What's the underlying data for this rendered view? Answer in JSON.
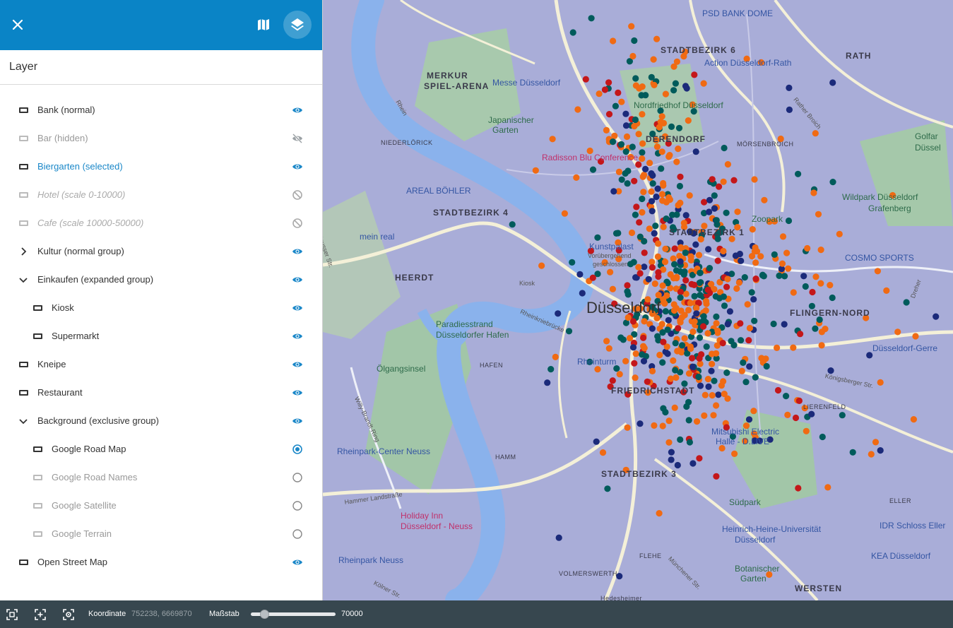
{
  "header": {
    "close_icon": "close-icon",
    "map_icon": "map-icon",
    "layers_icon": "layers-icon",
    "accent_color": "#0a84c6"
  },
  "panel": {
    "title": "Layer"
  },
  "layers": [
    {
      "label": "Bank (normal)",
      "level": 0,
      "state": "visible"
    },
    {
      "label": "Bar (hidden)",
      "level": 0,
      "state": "hidden"
    },
    {
      "label": "Biergarten (selected)",
      "level": 0,
      "state": "selected"
    },
    {
      "label": "Hotel (scale 0-10000)",
      "level": 0,
      "state": "outofscale"
    },
    {
      "label": "Cafe (scale 10000-50000)",
      "level": 0,
      "state": "outofscale"
    },
    {
      "label": "Kultur (normal group)",
      "level": 0,
      "state": "visible",
      "group": "collapsed"
    },
    {
      "label": "Einkaufen (expanded group)",
      "level": 0,
      "state": "visible",
      "group": "expanded"
    },
    {
      "label": "Kiosk",
      "level": 1,
      "state": "visible"
    },
    {
      "label": "Supermarkt",
      "level": 1,
      "state": "visible"
    },
    {
      "label": "Kneipe",
      "level": 0,
      "state": "visible"
    },
    {
      "label": "Restaurant",
      "level": 0,
      "state": "visible"
    },
    {
      "label": "Background (exclusive group)",
      "level": 0,
      "state": "visible",
      "group": "expanded"
    },
    {
      "label": "Google Road Map",
      "level": 1,
      "state": "radio-on"
    },
    {
      "label": "Google Road Names",
      "level": 1,
      "state": "radio-off"
    },
    {
      "label": "Google Satellite",
      "level": 1,
      "state": "radio-off"
    },
    {
      "label": "Google Terrain",
      "level": 1,
      "state": "radio-off"
    },
    {
      "label": "Open Street Map",
      "level": 0,
      "state": "visible"
    }
  ],
  "map": {
    "labels": [
      {
        "text": "STADTBEZIRK 6",
        "cls": "ml-district"
      },
      {
        "text": "RATH",
        "cls": "ml-district"
      },
      {
        "text": "PSD BANK DOME",
        "cls": "ml-poi-blue"
      },
      {
        "text": "MERKUR",
        "cls": "ml-district"
      },
      {
        "text": "SPIEL-ARENA",
        "cls": "ml-district"
      },
      {
        "text": "Messe Düsseldorf",
        "cls": "ml-poi-blue"
      },
      {
        "text": "Japanischer",
        "cls": "ml-poi"
      },
      {
        "text": "Garten",
        "cls": "ml-poi"
      },
      {
        "text": "Nordfriedhof Düsseldorf",
        "cls": "ml-poi"
      },
      {
        "text": "Action Düsseldorf-Rath",
        "cls": "ml-poi-blue"
      },
      {
        "text": "NIEDERLÖRICK",
        "cls": "ml-area"
      },
      {
        "text": "DERENDORF",
        "cls": "ml-district"
      },
      {
        "text": "MÖRSENBROICH",
        "cls": "ml-area"
      },
      {
        "text": "Radisson Blu Conference",
        "cls": "ml-poi-pink"
      },
      {
        "text": "Wildpark Düsseldorf",
        "cls": "ml-poi"
      },
      {
        "text": "Grafenberg",
        "cls": "ml-poi"
      },
      {
        "text": "Golfar",
        "cls": "ml-poi"
      },
      {
        "text": "Düssel",
        "cls": "ml-poi"
      },
      {
        "text": "AREAL BÖHLER",
        "cls": "ml-poi-blue"
      },
      {
        "text": "STADTBEZIRK 4",
        "cls": "ml-district"
      },
      {
        "text": "STADTBEZIRK 1",
        "cls": "ml-district"
      },
      {
        "text": "Zoopark",
        "cls": "ml-poi"
      },
      {
        "text": "mein real",
        "cls": "ml-poi-blue"
      },
      {
        "text": "Kunstpalast",
        "cls": "ml-poi-blue"
      },
      {
        "text": "Vorübergehend",
        "cls": "ml-street"
      },
      {
        "text": "geschlossen",
        "cls": "ml-street"
      },
      {
        "text": "COSMO SPORTS",
        "cls": "ml-poi-blue"
      },
      {
        "text": "HEERDT",
        "cls": "ml-district"
      },
      {
        "text": "Düsseldorf",
        "cls": "ml-city"
      },
      {
        "text": "FLINGERN-NORD",
        "cls": "ml-district"
      },
      {
        "text": "Paradiesstrand",
        "cls": "ml-poi"
      },
      {
        "text": "Düsseldorfer Hafen",
        "cls": "ml-poi"
      },
      {
        "text": "Rheinturm",
        "cls": "ml-poi-blue"
      },
      {
        "text": "Ölgangsinsel",
        "cls": "ml-poi"
      },
      {
        "text": "HAFEN",
        "cls": "ml-area"
      },
      {
        "text": "FRIEDRICHSTADT",
        "cls": "ml-district"
      },
      {
        "text": "LIERENFELD",
        "cls": "ml-area"
      },
      {
        "text": "Düsseldorf-Gerre",
        "cls": "ml-poi-blue"
      },
      {
        "text": "Rheinpark-Center Neuss",
        "cls": "ml-poi-blue"
      },
      {
        "text": "HAMM",
        "cls": "ml-area"
      },
      {
        "text": "Mitsubishi Electric",
        "cls": "ml-poi-blue"
      },
      {
        "text": "Halle - D.LIVE",
        "cls": "ml-poi-blue"
      },
      {
        "text": "STADTBEZIRK 3",
        "cls": "ml-district"
      },
      {
        "text": "Holiday Inn",
        "cls": "ml-poi-pink"
      },
      {
        "text": "Düsseldorf - Neuss",
        "cls": "ml-poi-pink"
      },
      {
        "text": "Südpark",
        "cls": "ml-poi"
      },
      {
        "text": "ELLER",
        "cls": "ml-area"
      },
      {
        "text": "IDR Schloss Eller",
        "cls": "ml-poi-blue"
      },
      {
        "text": "Heinrich-Heine-Universität",
        "cls": "ml-poi-blue"
      },
      {
        "text": "Düsseldorf",
        "cls": "ml-poi-blue"
      },
      {
        "text": "Rheinpark Neuss",
        "cls": "ml-poi-blue"
      },
      {
        "text": "FLEHE",
        "cls": "ml-area"
      },
      {
        "text": "VOLMERSWERTH",
        "cls": "ml-area"
      },
      {
        "text": "Botanischer",
        "cls": "ml-poi"
      },
      {
        "text": "Garten",
        "cls": "ml-poi"
      },
      {
        "text": "WERSTEN",
        "cls": "ml-district"
      },
      {
        "text": "KEA Düsseldorf",
        "cls": "ml-poi-blue"
      },
      {
        "text": "Hedesheimer",
        "cls": "ml-area"
      },
      {
        "text": "Neusser Str.",
        "cls": "ml-street"
      },
      {
        "text": "Willy-Brandt-Ring",
        "cls": "ml-street"
      },
      {
        "text": "Hammer Landstraße",
        "cls": "ml-street"
      },
      {
        "text": "Kölner Str.",
        "cls": "ml-street"
      },
      {
        "text": "Rheinkniebrücke",
        "cls": "ml-street"
      },
      {
        "text": "Königsberger Str.",
        "cls": "ml-street"
      },
      {
        "text": "Münchener Str.",
        "cls": "ml-street"
      },
      {
        "text": "Rather Broich",
        "cls": "ml-street"
      },
      {
        "text": "Dreher",
        "cls": "ml-street"
      },
      {
        "text": "Rhein",
        "cls": "ml-street"
      },
      {
        "text": "Kiosk",
        "cls": "ml-street"
      }
    ],
    "marker_colors": {
      "dark": "#005b5b",
      "orange": "#f06a13",
      "red": "#c4171a",
      "navy": "#1b2a7a"
    },
    "marker_count": 720
  },
  "statusbar": {
    "fit_icon": "fit-screen-icon",
    "zoom_extent_icon": "zoom-extent-icon",
    "locate_icon": "locate-icon",
    "coord_label": "Koordinate",
    "coord_value": "752238, 6669870",
    "scale_label": "Maßstab",
    "scale_value": "70000",
    "scale_slider_fraction": 0.12
  }
}
